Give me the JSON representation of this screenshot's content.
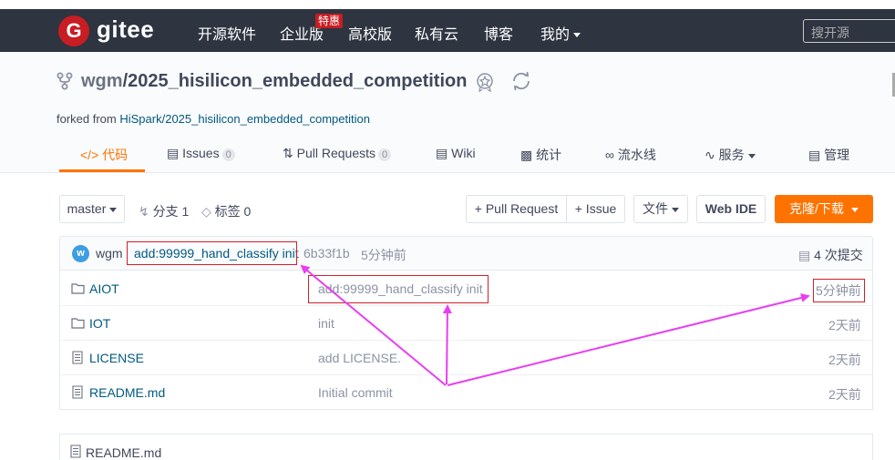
{
  "navbar": {
    "logo_letter": "G",
    "brand": "gitee",
    "items": [
      "开源软件",
      "企业版",
      "高校版",
      "私有云",
      "博客",
      "我的"
    ],
    "hot_badge": "特惠",
    "search_placeholder": "搜开源"
  },
  "repo": {
    "owner": "wgm",
    "separator": "/",
    "name": "2025_hisilicon_embedded_competition",
    "forked_prefix": "forked from ",
    "forked_from": "HiSpark/2025_hisilicon_embedded_competition"
  },
  "tabs": {
    "code": "代码",
    "issues": "Issues",
    "issues_count": "0",
    "pulls": "Pull Requests",
    "pulls_count": "0",
    "wiki": "Wiki",
    "stats": "统计",
    "pipeline": "流水线",
    "services": "服务",
    "manage": "管理"
  },
  "toolbar": {
    "branch": "master",
    "branches": "分支 1",
    "tags": "标签 0",
    "pull_request": "+ Pull Request",
    "issue": "+ Issue",
    "file": "文件",
    "web_ide": "Web IDE",
    "clone": "克隆/下载"
  },
  "commit": {
    "avatar_letter": "w",
    "author": "wgm",
    "message": "add:99999_hand_classify init",
    "sha": "6b33f1b",
    "time": "5分钟前",
    "total": "4 次提交"
  },
  "files": [
    {
      "name": "AIOT",
      "type": "folder",
      "message": "add:99999_hand_classify init",
      "time": "5分钟前"
    },
    {
      "name": "IOT",
      "type": "folder",
      "message": "init",
      "time": "2天前"
    },
    {
      "name": "LICENSE",
      "type": "file",
      "message": "add LICENSE.",
      "time": "2天前"
    },
    {
      "name": "README.md",
      "type": "file",
      "message": "Initial commit",
      "time": "2天前"
    }
  ],
  "readme": {
    "title": "README.md"
  },
  "colors": {
    "accent": "#fe7300",
    "annotation_arrow": "#e83ff0",
    "annotation_box": "#d0202a",
    "navbar": "#2e3440"
  }
}
